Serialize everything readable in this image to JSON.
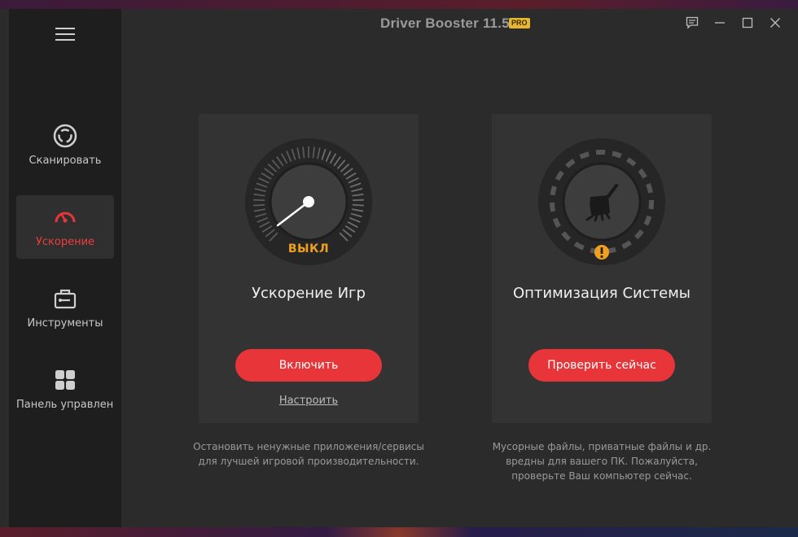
{
  "window": {
    "title": "Driver Booster 11.5",
    "badge": "PRO"
  },
  "sidebar": {
    "items": [
      {
        "label": "Сканировать",
        "icon": "scan-icon"
      },
      {
        "label": "Ускорение",
        "icon": "speedometer-icon",
        "active": true
      },
      {
        "label": "Инструменты",
        "icon": "toolbox-icon"
      },
      {
        "label": "Панель управлен...",
        "icon": "dashboard-icon"
      }
    ]
  },
  "cards": {
    "game_boost": {
      "title": "Ускорение Игр",
      "status": "ВЫКЛ",
      "button": "Включить",
      "link": "Настроить",
      "description": [
        "Остановить ненужные приложения/сервисы",
        "для лучшей игровой производительности."
      ],
      "icon": "gauge-icon"
    },
    "system_optimize": {
      "title": "Оптимизация Системы",
      "button": "Проверить сейчас",
      "description": [
        "Мусорные файлы, приватные файлы и др.",
        "вредны для вашего ПК. Пожалуйста,",
        "проверьте Ваш компьютер сейчас."
      ],
      "icon": "broom-icon",
      "warning_icon": "warning-icon"
    }
  },
  "colors": {
    "accent": "#e8353a",
    "active_label": "#ef3d3d",
    "status_off": "#f0a020",
    "pro_badge": "#e8b730"
  }
}
